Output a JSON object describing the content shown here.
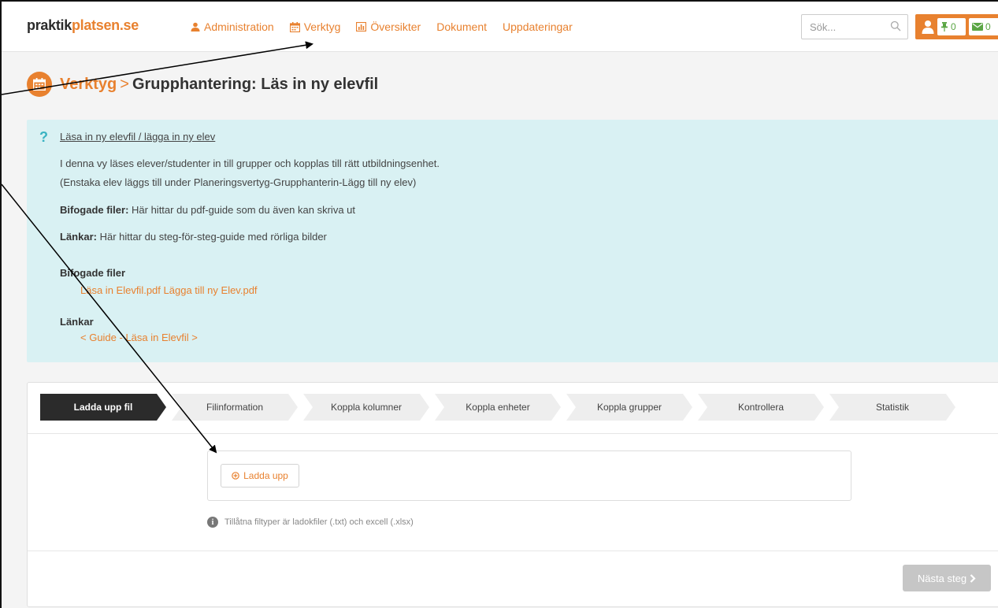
{
  "navbar": {
    "brand_part1": "praktik",
    "brand_part2": "platsen.se",
    "items": [
      {
        "label": "Administration",
        "icon": "user-icon"
      },
      {
        "label": "Verktyg",
        "icon": "calendar-icon"
      },
      {
        "label": "Översikter",
        "icon": "bar-chart-icon"
      },
      {
        "label": "Dokument",
        "icon": ""
      },
      {
        "label": "Uppdateringar",
        "icon": ""
      }
    ],
    "search_placeholder": "Sök...",
    "pin_count": "0",
    "mail_count": "0"
  },
  "page": {
    "crumb": "Verktyg",
    "separator": ">",
    "title": "Grupphantering: Läs in ny elevfil"
  },
  "info": {
    "link": "Läsa in ny elevfil / lägga in ny elev",
    "line1": "I denna vy läses elever/studenter in till grupper och kopplas till rätt utbildningsenhet.",
    "line2": "(Enstaka elev läggs till under Planeringsvertyg-Grupphanterin-Lägg till ny elev)",
    "files_label": "Bifogade filer:",
    "files_text": " Här hittar du pdf-guide som du även kan skriva ut",
    "links_label": "Länkar:",
    "links_text": " Här hittar du steg-för-steg-guide med rörliga bilder",
    "attached_heading": "Bifogade filer",
    "file1": "Läsa in Elevfil.pdf",
    "file2": "Lägga till ny Elev.pdf",
    "links_heading": "Länkar",
    "guide_link": "< Guide - Läsa in Elevfil >"
  },
  "wizard": {
    "steps": [
      "Ladda upp fil",
      "Filinformation",
      "Koppla kolumner",
      "Koppla enheter",
      "Koppla grupper",
      "Kontrollera",
      "Statistik"
    ],
    "active_step": 0,
    "upload_label": "Ladda upp",
    "hint": "Tillåtna filtyper är ladokfiler (.txt) och excell (.xlsx)",
    "next_label": "Nästa steg"
  },
  "colors": {
    "accent": "#e8812f",
    "info_bg": "#d9f1f3",
    "active_step": "#2b2b2b",
    "inactive_step": "#eeeeee",
    "disabled_button": "#c6c6c6"
  }
}
